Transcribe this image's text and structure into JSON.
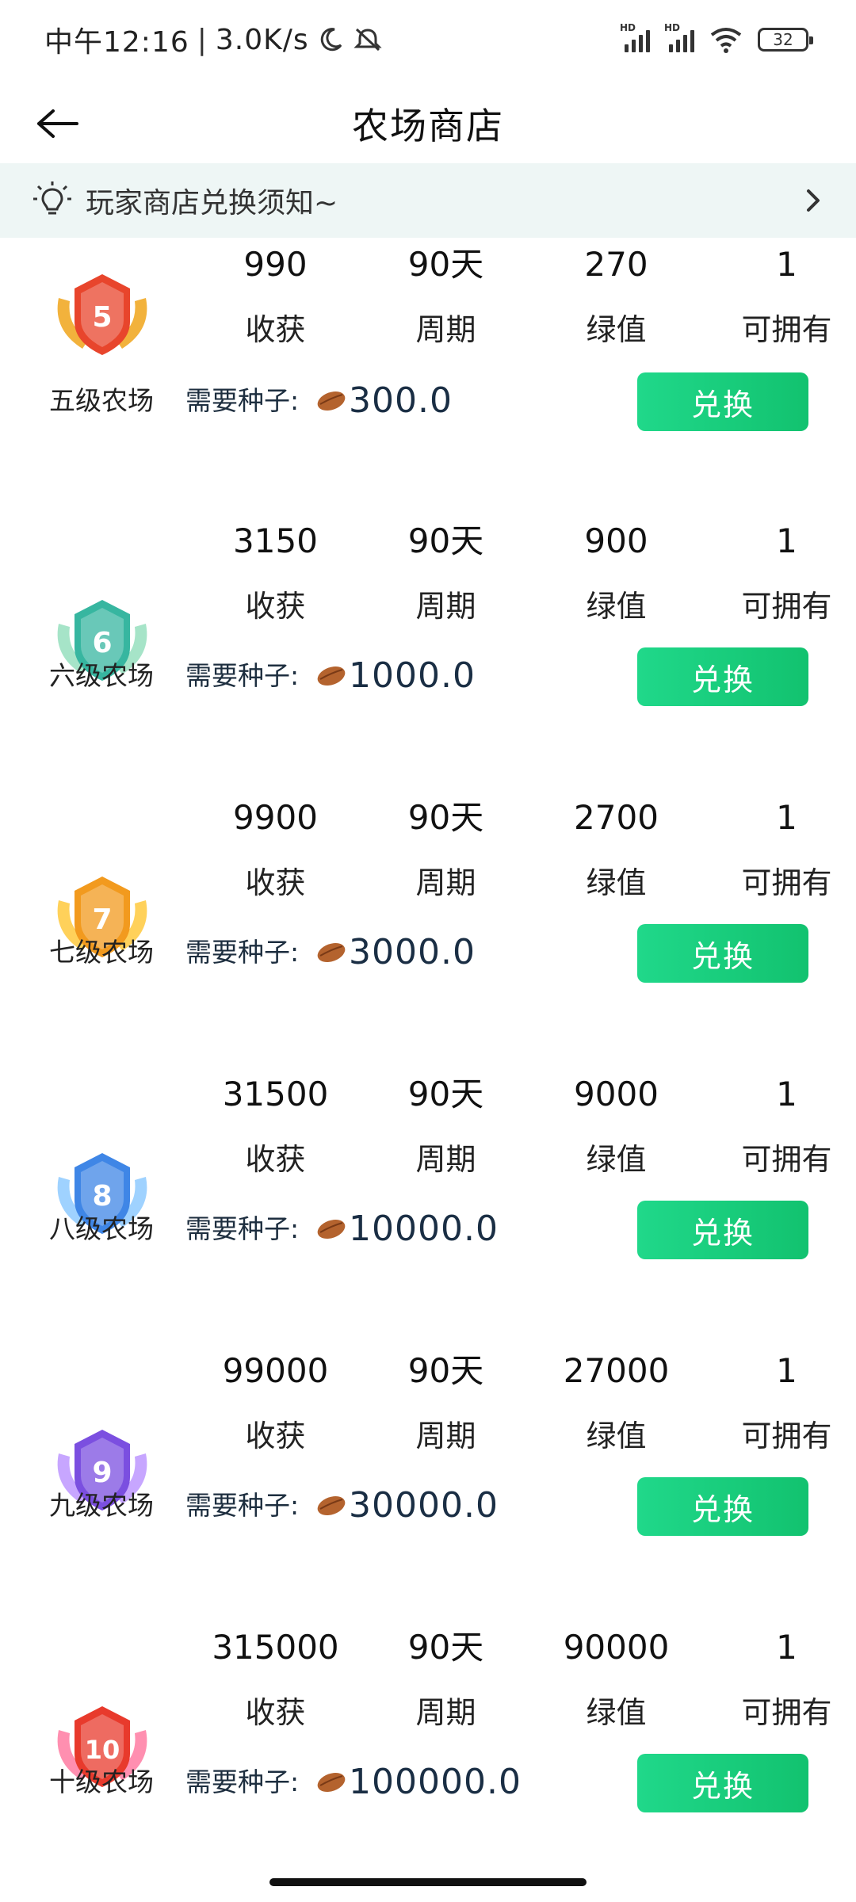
{
  "status_bar": {
    "time": "中午12:16",
    "separator": "|",
    "speed": "3.0K/s",
    "sim1_label": "HD",
    "sim2_label": "HD",
    "battery": "32"
  },
  "header": {
    "title": "农场商店"
  },
  "notice": {
    "text": "玩家商店兑换须知~"
  },
  "labels": {
    "harvest": "收获",
    "period": "周期",
    "green_value": "绿值",
    "ownable": "可拥有",
    "need_seeds": "需要种子:",
    "redeem": "兑换"
  },
  "farms": [
    {
      "level": "5",
      "name": "五级农场",
      "harvest": "990",
      "period": "90天",
      "green_value": "270",
      "ownable": "1",
      "seeds": "300.0",
      "badge_color": "#e8452c",
      "badge_wing": "#f2b23c"
    },
    {
      "level": "6",
      "name": "六级农场",
      "harvest": "3150",
      "period": "90天",
      "green_value": "900",
      "ownable": "1",
      "seeds": "1000.0",
      "badge_color": "#37b6a0",
      "badge_wing": "#a6e4c8"
    },
    {
      "level": "7",
      "name": "七级农场",
      "harvest": "9900",
      "period": "90天",
      "green_value": "2700",
      "ownable": "1",
      "seeds": "3000.0",
      "badge_color": "#f29a1e",
      "badge_wing": "#ffd15a"
    },
    {
      "level": "8",
      "name": "八级农场",
      "harvest": "31500",
      "period": "90天",
      "green_value": "9000",
      "ownable": "1",
      "seeds": "10000.0",
      "badge_color": "#3f86e6",
      "badge_wing": "#9fd2ff"
    },
    {
      "level": "9",
      "name": "九级农场",
      "harvest": "99000",
      "period": "90天",
      "green_value": "27000",
      "ownable": "1",
      "seeds": "30000.0",
      "badge_color": "#7b4fe0",
      "badge_wing": "#c7a6ff"
    },
    {
      "level": "10",
      "name": "十级农场",
      "harvest": "315000",
      "period": "90天",
      "green_value": "90000",
      "ownable": "1",
      "seeds": "100000.0",
      "badge_color": "#e83a2c",
      "badge_wing": "#ff8fb0"
    }
  ],
  "colors": {
    "accent": "#16c97a",
    "notice_bg": "#eef6f5"
  }
}
